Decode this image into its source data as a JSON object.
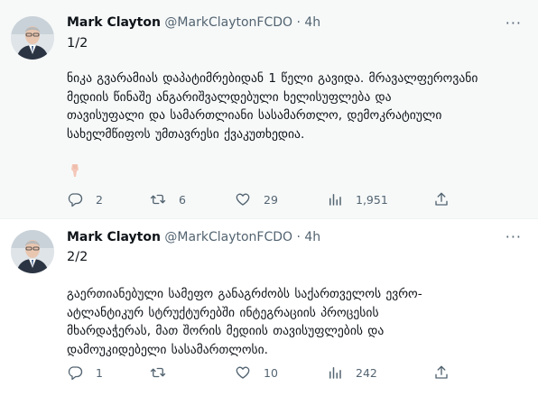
{
  "tweets": [
    {
      "author_name": "Mark Clayton",
      "handle": "@MarkClaytonFCDO",
      "time": "4h",
      "thread_index": "1/2",
      "lines": [
        "ნიკა გვარამიას დაპატიმრებიდან 1 წელი გავიდა. მრავალფეროვანი",
        "მედიის წინაშე ანგარიშვალდებული ხელისუფლება და",
        "თავისუფალი და სამართლიანი სასამართლო, დემოკრატიული",
        "სახელმწიფოს უმთავრესი ქვაკუთხედია."
      ],
      "stats": {
        "replies": "2",
        "retweets": "6",
        "likes": "29",
        "views": "1,951"
      }
    },
    {
      "author_name": "Mark Clayton",
      "handle": "@MarkClaytonFCDO",
      "time": "4h",
      "thread_index": "2/2",
      "lines": [
        "გაერთიანებული სამეფო განაგრძობს საქართველოს ევრო-",
        "ატლანტიკურ სტრუქტურებში ინტეგრაციის პროცესის",
        "მხარდაჭერას, მათ შორის მედიის თავისუფლების და",
        "დამოუკიდებელი სასამართლოსი."
      ],
      "stats": {
        "replies": "1",
        "retweets": "",
        "likes": "10",
        "views": "242"
      }
    }
  ],
  "icons": {
    "more": "more-horizontal-icon",
    "reply": "reply-icon",
    "retweet": "retweet-icon",
    "like": "heart-icon",
    "views": "views-chart-icon",
    "share": "share-icon",
    "emoji": "pointing-down-hand-emoji"
  },
  "colors": {
    "text": "#0f1419",
    "secondary": "#536471",
    "thread_line": "#cfd9de",
    "highlight_bg": "#f7f9f9"
  }
}
